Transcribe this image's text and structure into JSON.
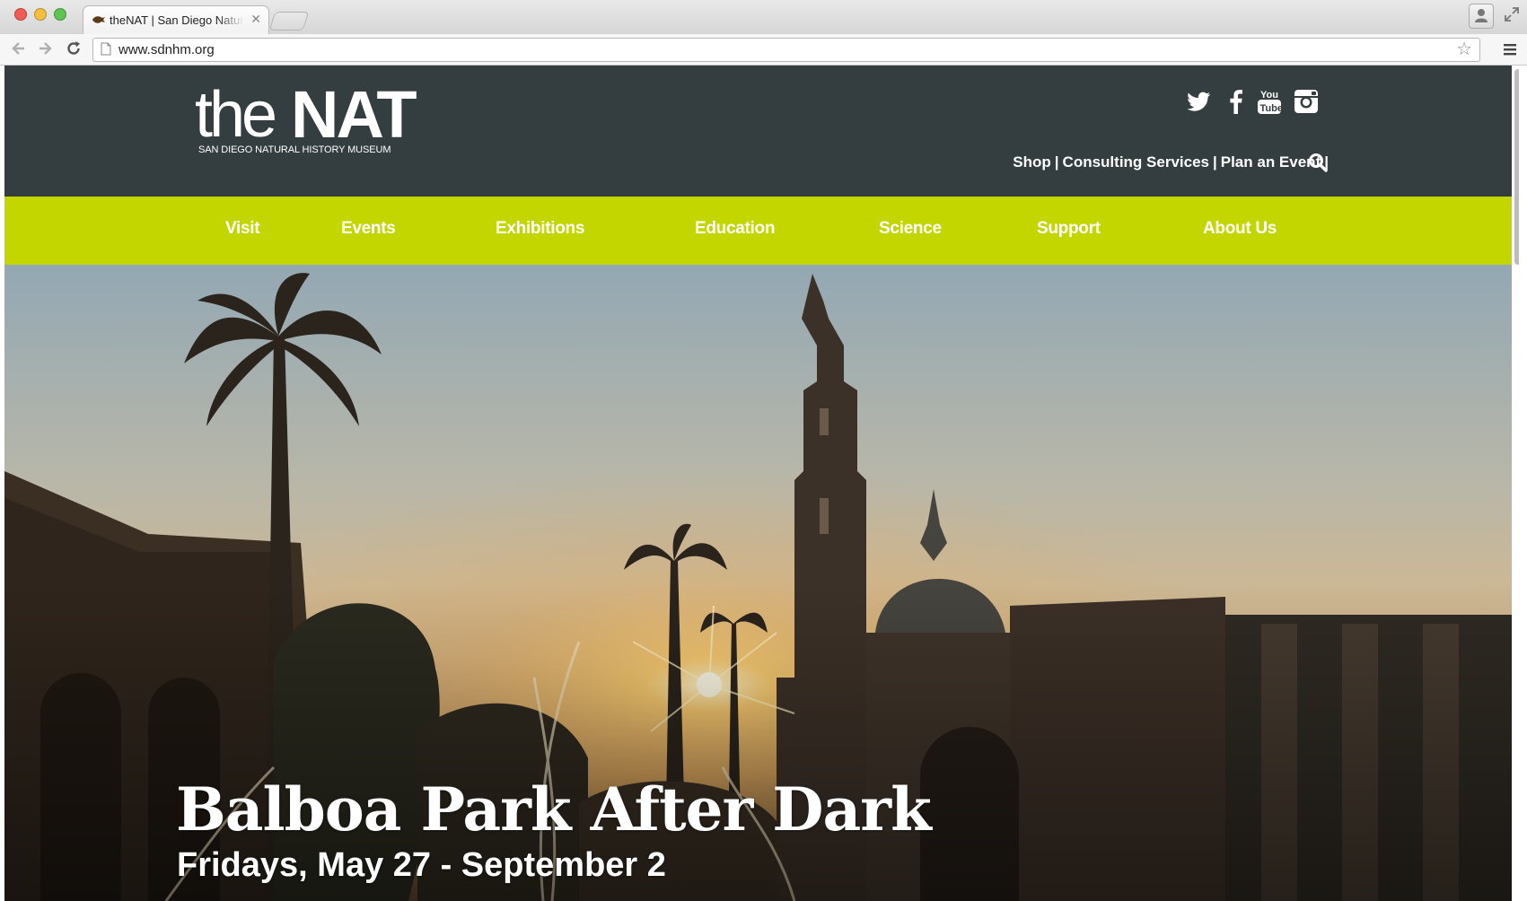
{
  "browser": {
    "tab_title": "theNAT | San Diego Natural History Museum",
    "url": "www.sdnhm.org"
  },
  "header": {
    "logo_the": "the",
    "logo_nat": "NAT",
    "logo_sub": "SAN DIEGO NATURAL HISTORY MUSEUM",
    "social": [
      "twitter-icon",
      "facebook-icon",
      "youtube-icon",
      "instagram-icon"
    ],
    "utility_links": [
      "Shop",
      "Consulting Services",
      "Plan an Event"
    ],
    "utility_sep": "|"
  },
  "nav": {
    "items": [
      "Visit",
      "Events",
      "Exhibitions",
      "Education",
      "Science",
      "Support",
      "About Us"
    ]
  },
  "hero": {
    "title": "Balboa Park After Dark",
    "subtitle": "Fridays, May 27 - September 2"
  },
  "colors": {
    "header_bg": "#343d3f",
    "nav_bg": "#c4d600",
    "text": "#ffffff"
  }
}
